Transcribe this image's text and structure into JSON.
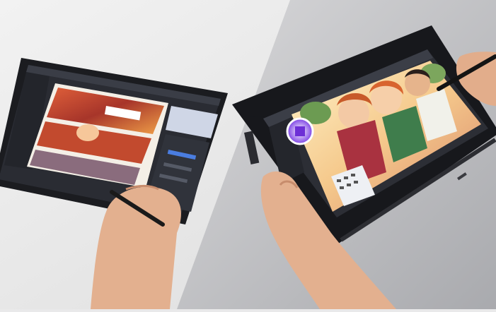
{
  "scene": {
    "left_device": "tablet",
    "right_device": "pen-display",
    "colors": {
      "left_background": "#ececec",
      "right_background": "#b9b9bb",
      "device_frame": "#1c1d21",
      "app_ui": "#2b2d33",
      "skin": "#e6b596"
    }
  }
}
